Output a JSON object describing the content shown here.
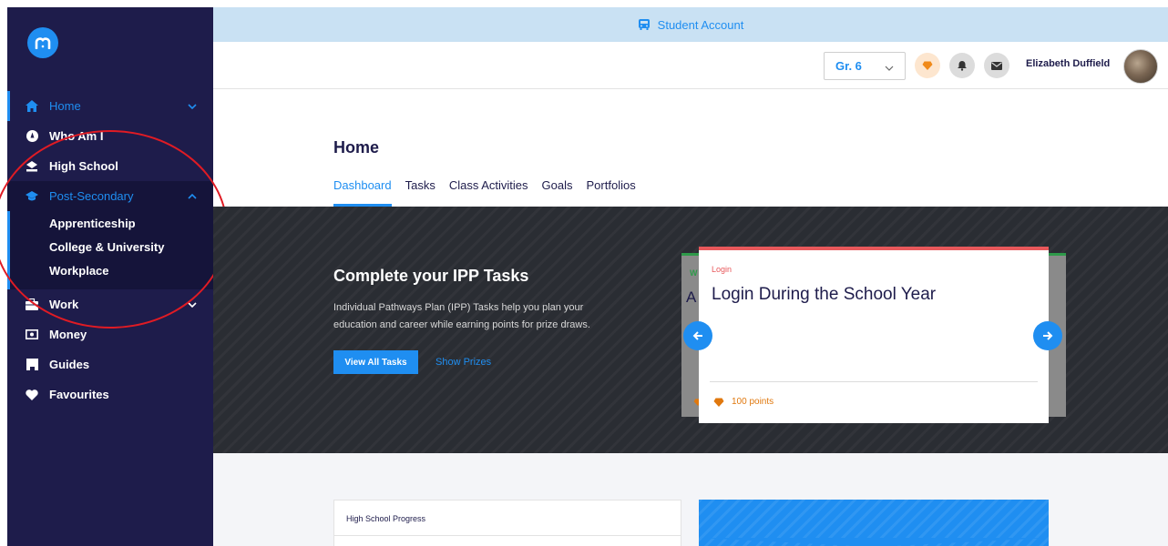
{
  "banner": {
    "text": "Student Account",
    "icon": "bus-icon"
  },
  "sidebar": {
    "logo": "m",
    "items": [
      {
        "label": "Home",
        "icon": "home-icon"
      },
      {
        "label": "Who Am I",
        "icon": "compass-icon"
      },
      {
        "label": "High School",
        "icon": "school-icon"
      },
      {
        "label": "Post-Secondary",
        "icon": "graduation-cap-icon"
      },
      {
        "label": "Work",
        "icon": "briefcase-icon"
      },
      {
        "label": "Money",
        "icon": "money-icon"
      },
      {
        "label": "Guides",
        "icon": "book-icon"
      },
      {
        "label": "Favourites",
        "icon": "heart-icon"
      }
    ],
    "sub_items": [
      "Apprenticeship",
      "College & University",
      "Workplace"
    ]
  },
  "header": {
    "grade": "Gr. 6",
    "user_name": "Elizabeth Duffield"
  },
  "page": {
    "title": "Home",
    "tabs": [
      "Dashboard",
      "Tasks",
      "Class Activities",
      "Goals",
      "Portfolios"
    ]
  },
  "hero": {
    "title": "Complete your IPP Tasks",
    "description": "Individual Pathways Plan (IPP) Tasks help you plan your education and career while earning points for prize draws.",
    "primary_button": "View All Tasks",
    "secondary_link": "Show Prizes"
  },
  "cards": {
    "back": {
      "tag": "W",
      "title_fragment": "A"
    },
    "front": {
      "tag": "Login",
      "title": "Login During the School Year",
      "points": "100 points"
    }
  },
  "bottom": {
    "progress_title": "High School Progress"
  },
  "colors": {
    "accent": "#1f8ef1",
    "navy": "#1e1c4b",
    "points_orange": "#e0780e",
    "login_red": "#e8585b"
  }
}
